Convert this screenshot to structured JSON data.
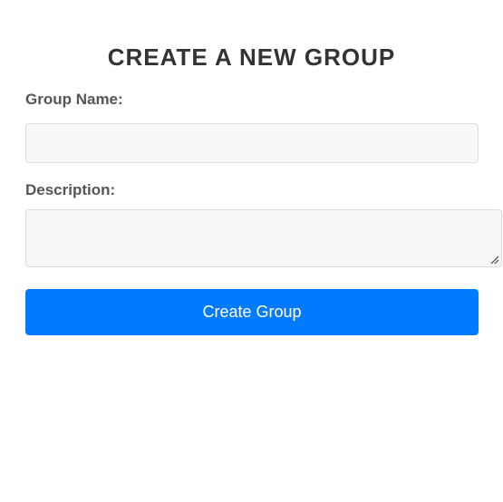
{
  "form": {
    "title": "CREATE A NEW GROUP",
    "group_name": {
      "label": "Group Name:",
      "value": "",
      "placeholder": ""
    },
    "description": {
      "label": "Description:",
      "value": "",
      "placeholder": ""
    },
    "submit_label": "Create Group"
  },
  "colors": {
    "primary_button": "#007bff",
    "button_text": "#ffffff",
    "title_text": "#333333",
    "label_text": "#555555",
    "input_background": "#f8f8f8",
    "input_border": "#dddddd",
    "page_background": "#ffffff"
  },
  "icons": {
    "textarea_resize": "resize-grip-icon"
  }
}
